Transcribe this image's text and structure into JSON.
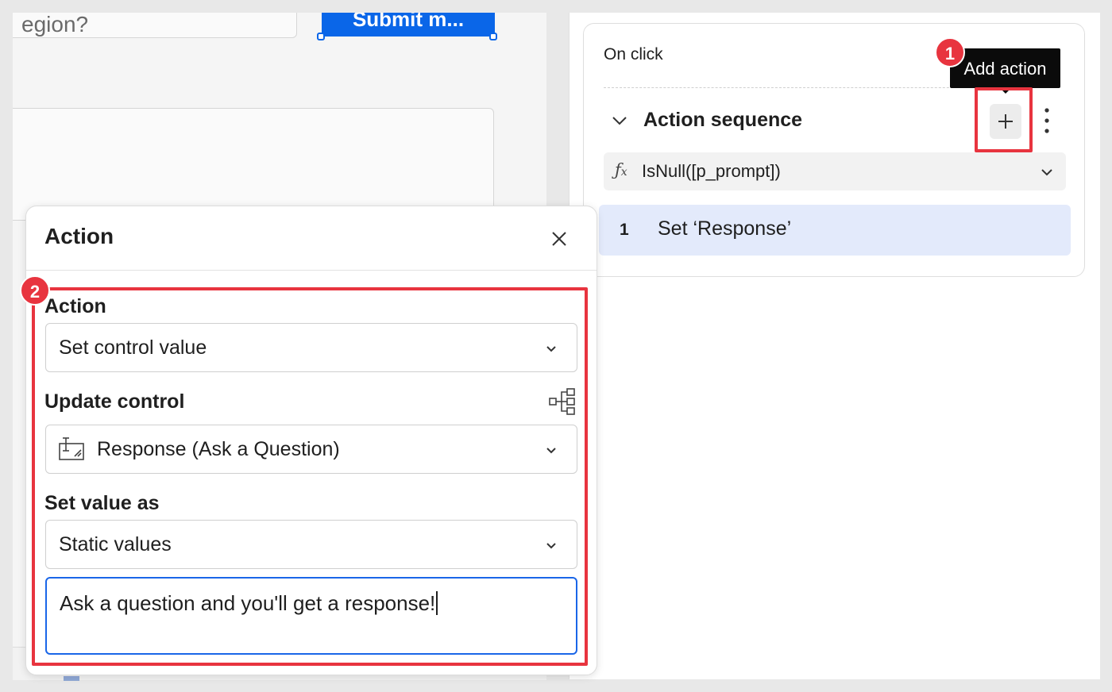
{
  "canvas": {
    "field_text": "egion?",
    "submit_label": "Submit m..."
  },
  "on_click": {
    "label": "On click",
    "tooltip": "Add action",
    "sequence_title": "Action sequence",
    "condition": "IsNull([p_prompt])",
    "condition_icon": "fx-icon",
    "steps": [
      {
        "number": "1",
        "label": "Set ‘Response’"
      }
    ]
  },
  "action_panel": {
    "title": "Action",
    "action_label": "Action",
    "action_value": "Set control value",
    "update_label": "Update control",
    "control_value": "Response (Ask a Question)",
    "set_value_label": "Set value as",
    "set_value_value": "Static values",
    "static_text": "Ask a question and you'll get a response!"
  },
  "annotations": {
    "badge_1": "1",
    "badge_2": "2",
    "highlight_color": "#e8343f"
  },
  "colors": {
    "accent": "#0a66e8",
    "step_highlight": "#e3eafb"
  }
}
